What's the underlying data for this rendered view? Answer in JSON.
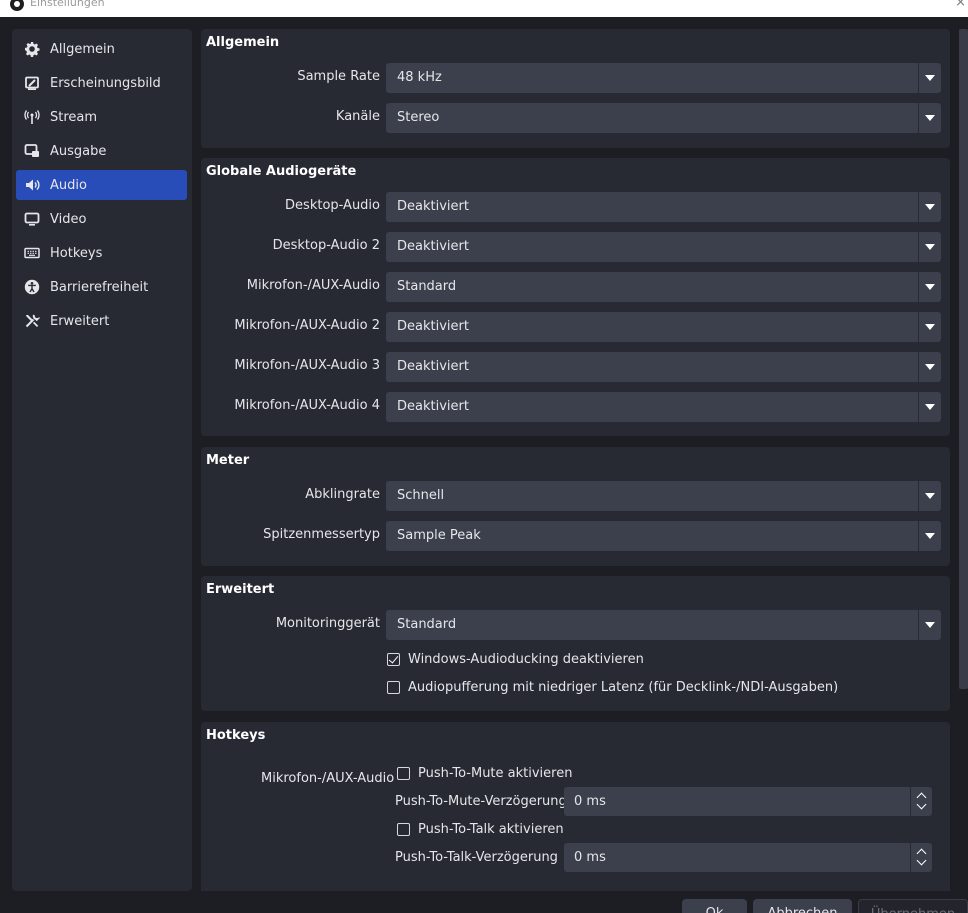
{
  "window": {
    "title": "Einstellungen",
    "close_label": "×"
  },
  "sidebar": {
    "items": [
      {
        "label": "Allgemein",
        "icon": "gear-icon",
        "active": false
      },
      {
        "label": "Erscheinungsbild",
        "icon": "appearance-icon",
        "active": false
      },
      {
        "label": "Stream",
        "icon": "antenna-icon",
        "active": false
      },
      {
        "label": "Ausgabe",
        "icon": "output-icon",
        "active": false
      },
      {
        "label": "Audio",
        "icon": "speaker-icon",
        "active": true
      },
      {
        "label": "Video",
        "icon": "monitor-icon",
        "active": false
      },
      {
        "label": "Hotkeys",
        "icon": "keyboard-icon",
        "active": false
      },
      {
        "label": "Barrierefreiheit",
        "icon": "accessibility-icon",
        "active": false
      },
      {
        "label": "Erweitert",
        "icon": "tools-icon",
        "active": false
      }
    ]
  },
  "general": {
    "title": "Allgemein",
    "sample_rate": {
      "label": "Sample Rate",
      "value": "48 kHz"
    },
    "channels": {
      "label": "Kanäle",
      "value": "Stereo"
    }
  },
  "devices": {
    "title": "Globale Audiogeräte",
    "rows": [
      {
        "label": "Desktop-Audio",
        "value": "Deaktiviert"
      },
      {
        "label": "Desktop-Audio 2",
        "value": "Deaktiviert"
      },
      {
        "label": "Mikrofon-/AUX-Audio",
        "value": "Standard"
      },
      {
        "label": "Mikrofon-/AUX-Audio 2",
        "value": "Deaktiviert"
      },
      {
        "label": "Mikrofon-/AUX-Audio 3",
        "value": "Deaktiviert"
      },
      {
        "label": "Mikrofon-/AUX-Audio 4",
        "value": "Deaktiviert"
      }
    ]
  },
  "meter": {
    "title": "Meter",
    "decay": {
      "label": "Abklingrate",
      "value": "Schnell"
    },
    "peak": {
      "label": "Spitzenmessertyp",
      "value": "Sample Peak"
    }
  },
  "advanced": {
    "title": "Erweitert",
    "monitoring": {
      "label": "Monitoringgerät",
      "value": "Standard"
    },
    "ducking": {
      "label": "Windows-Audioducking deaktivieren",
      "checked": true
    },
    "low_latency": {
      "label": "Audiopufferung mit niedriger Latenz (für Decklink-/NDI-Ausgaben)",
      "checked": false
    }
  },
  "hotkeys": {
    "title": "Hotkeys",
    "source_label": "Mikrofon-/AUX-Audio",
    "push_to_mute": {
      "label": "Push-To-Mute aktivieren",
      "checked": false
    },
    "push_to_mute_delay": {
      "label": "Push-To-Mute-Verzögerung",
      "value": "0 ms"
    },
    "push_to_talk": {
      "label": "Push-To-Talk aktivieren",
      "checked": false
    },
    "push_to_talk_delay": {
      "label": "Push-To-Talk-Verzögerung",
      "value": "0 ms"
    }
  },
  "footer": {
    "ok": "Ok",
    "cancel": "Abbrechen",
    "apply": "Übernehmen"
  },
  "colors": {
    "accent": "#284cb8",
    "panel": "#272a33",
    "background": "#1d1e24",
    "control": "#3c404d"
  }
}
